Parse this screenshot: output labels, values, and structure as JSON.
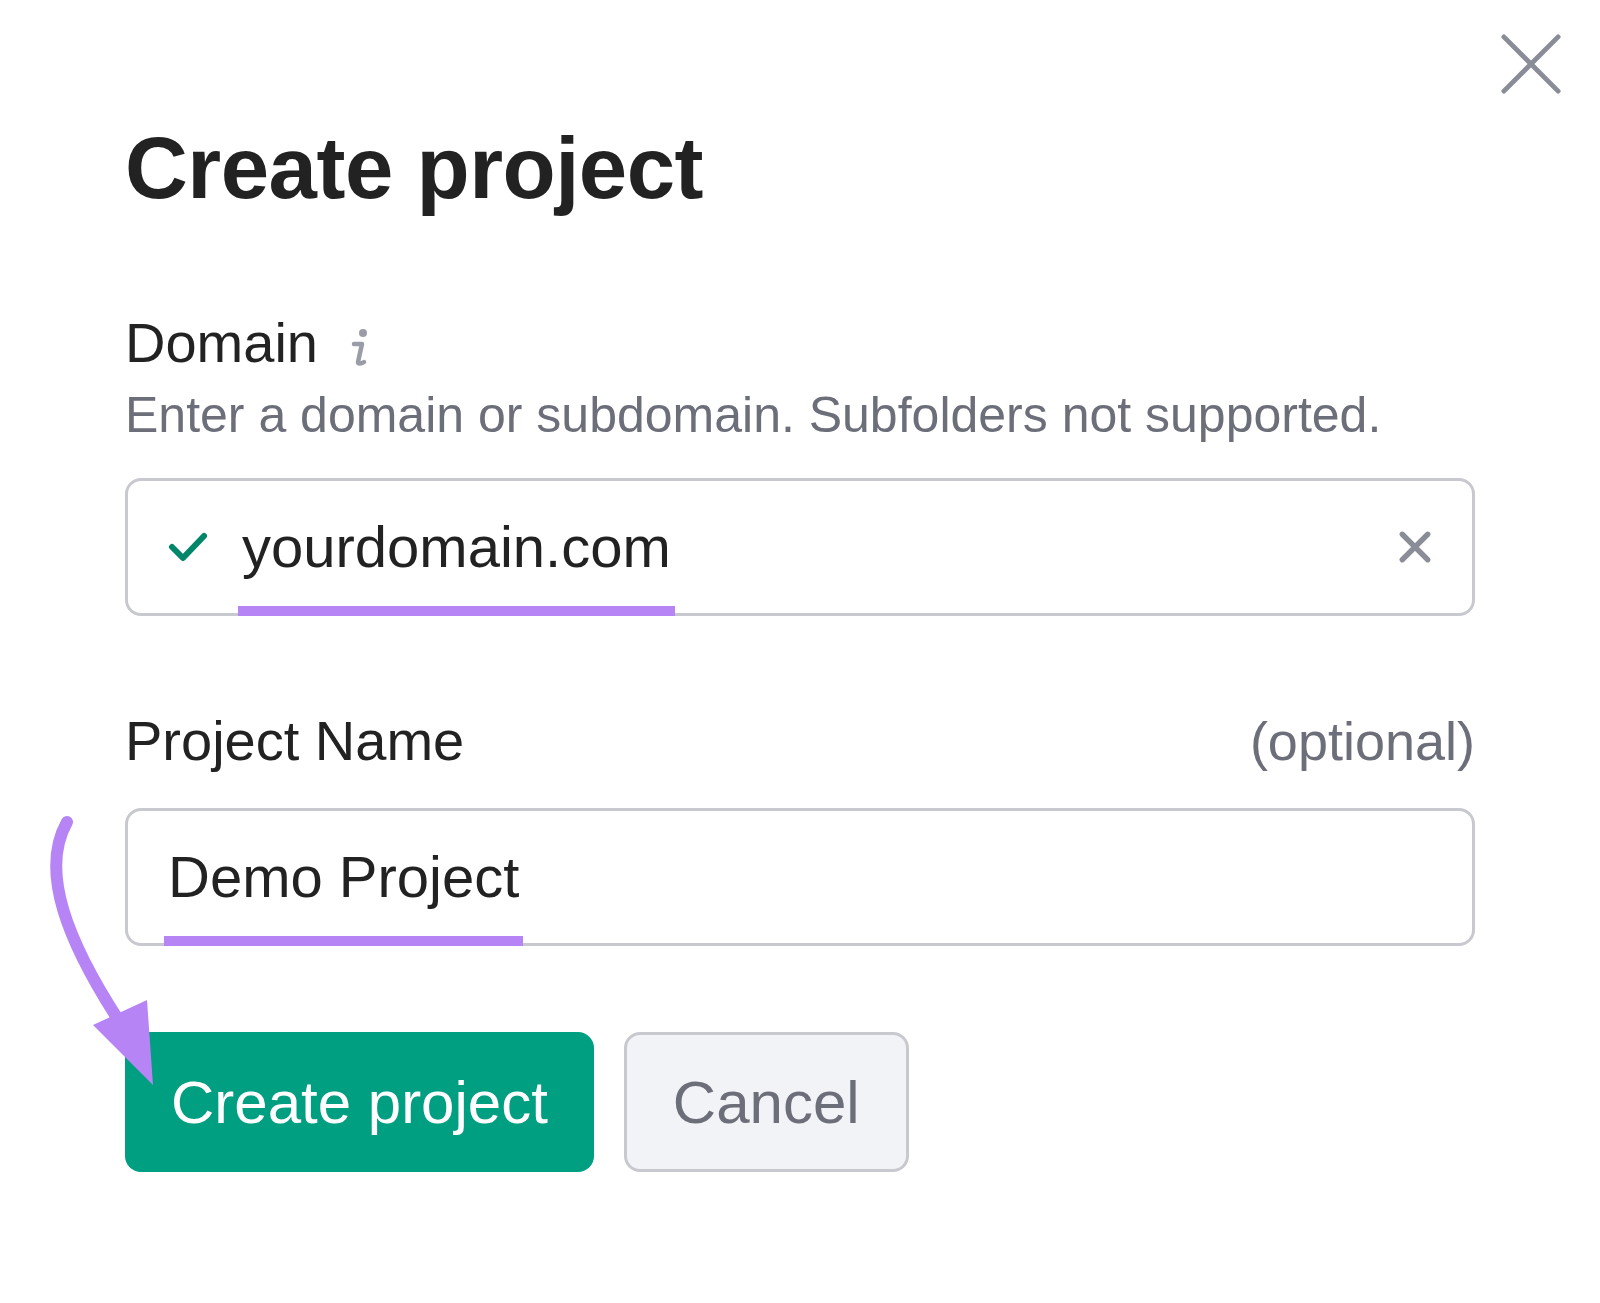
{
  "dialog": {
    "title": "Create project"
  },
  "fields": [
    {
      "label": "Domain",
      "info": true,
      "hint": "Enter a domain or subdomain. Subfolders not supported.",
      "value": "yourdomain.com",
      "valid": true,
      "clearable": true
    },
    {
      "label": "Project Name",
      "info": false,
      "note": "(optional)",
      "value": "Demo Project",
      "valid": false,
      "clearable": false
    }
  ],
  "buttons": [
    {
      "label": "Create project",
      "kind": "primary"
    },
    {
      "label": "Cancel",
      "kind": "secondary"
    }
  ]
}
